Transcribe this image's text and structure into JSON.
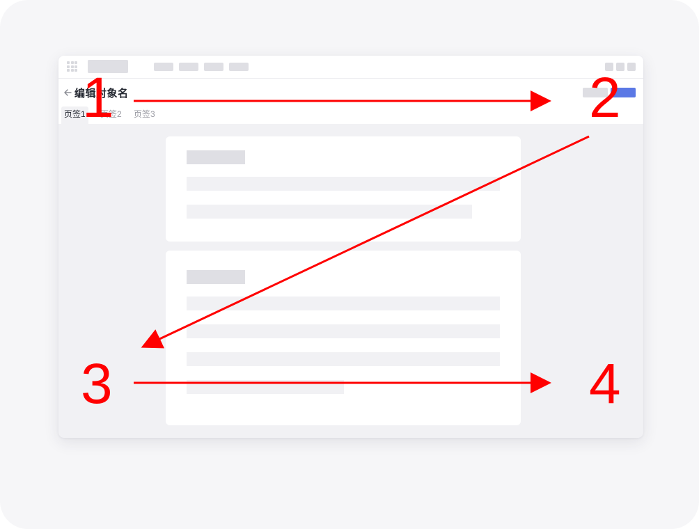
{
  "window": {
    "page_title": "编辑对象名",
    "tabs": [
      {
        "label": "页签1",
        "active": true
      },
      {
        "label": "页签2",
        "active": false
      },
      {
        "label": "页签3",
        "active": false
      }
    ],
    "primary_color": "#5b78e5"
  },
  "icons": {
    "app_grid": "grid-icon",
    "back": "arrow-left-icon"
  },
  "annotations": {
    "color": "#ff0000",
    "steps": [
      {
        "label": "1"
      },
      {
        "label": "2"
      },
      {
        "label": "3"
      },
      {
        "label": "4"
      }
    ],
    "arrows": [
      {
        "from": "1",
        "to": "2"
      },
      {
        "from": "2",
        "to": "3"
      },
      {
        "from": "3",
        "to": "4"
      }
    ]
  }
}
